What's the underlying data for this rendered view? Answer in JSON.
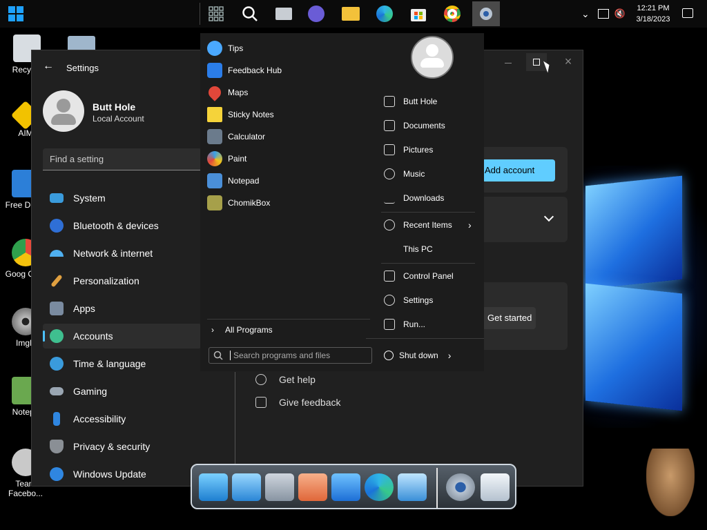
{
  "taskbar": {
    "clock_time": "12:21 PM",
    "clock_date": "3/18/2023"
  },
  "desktop_icons": [
    {
      "label": "Recycle",
      "color": "#d8dde2"
    },
    {
      "label": "AIM",
      "color": "#f2c200"
    },
    {
      "label": "Free Down",
      "color": "#2c7fd8"
    },
    {
      "label": "Goog Chro",
      "color": "#e84a3b"
    },
    {
      "label": "ImgB",
      "color": "#888888"
    },
    {
      "label": "Notepa",
      "color": "#6aa84f"
    },
    {
      "label": "Team Facebo...",
      "color": "#c9c9c9"
    }
  ],
  "settings": {
    "title": "Settings",
    "user_name": "Butt Hole",
    "account_type": "Local Account",
    "search_placeholder": "Find a setting",
    "nav": [
      {
        "label": "System",
        "color": "#3a9bdc"
      },
      {
        "label": "Bluetooth & devices",
        "color": "#2f6fd6"
      },
      {
        "label": "Network & internet",
        "color": "#4fb0f0"
      },
      {
        "label": "Personalization",
        "color": "#e0a040"
      },
      {
        "label": "Apps",
        "color": "#7a8ba0"
      },
      {
        "label": "Accounts",
        "color": "#3fbf8f"
      },
      {
        "label": "Time & language",
        "color": "#3a9bdc"
      },
      {
        "label": "Gaming",
        "color": "#9aa6b2"
      },
      {
        "label": "Accessibility",
        "color": "#2f86e0"
      },
      {
        "label": "Privacy & security",
        "color": "#8a8f95"
      },
      {
        "label": "Windows Update",
        "color": "#2f86e0"
      }
    ],
    "add_account": "Add account",
    "get_started": "Get started",
    "help": {
      "get_help": "Get help",
      "give_feedback": "Give feedback"
    }
  },
  "start_menu": {
    "programs": [
      {
        "label": "Tips",
        "color": "#4aa8ff"
      },
      {
        "label": "Feedback Hub",
        "color": "#2b7de9"
      },
      {
        "label": "Maps",
        "color": "#e2473a"
      },
      {
        "label": "Sticky Notes",
        "color": "#f5d33a"
      },
      {
        "label": "Calculator",
        "color": "#6b7b8c"
      },
      {
        "label": "Paint",
        "color": "#3aa0e6"
      },
      {
        "label": "Notepad",
        "color": "#4a8fd8"
      },
      {
        "label": "ChomikBox",
        "color": "#a6a04a"
      }
    ],
    "all_programs": "All Programs",
    "search_placeholder": "Search programs and files",
    "right": [
      "Butt Hole",
      "Documents",
      "Pictures",
      "Music",
      "Downloads",
      "Recent Items",
      "This PC",
      "Control Panel",
      "Settings",
      "Run..."
    ],
    "shutdown": "Shut down"
  }
}
